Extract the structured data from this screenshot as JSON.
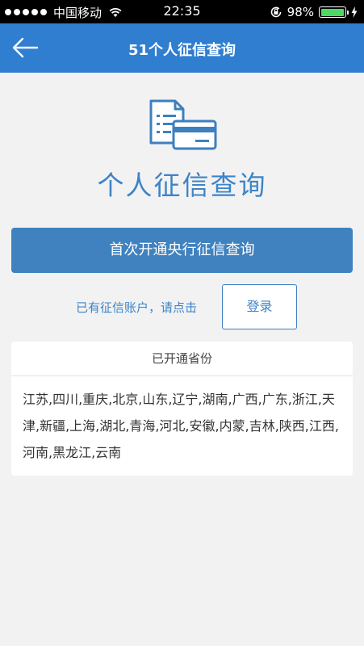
{
  "status_bar": {
    "carrier": "中国移动",
    "time": "22:35",
    "battery_percent": "98%",
    "battery_level": 0.98,
    "signal_bars": 5
  },
  "navbar": {
    "title": "51个人征信查询",
    "color": "#2f7ed0"
  },
  "hero": {
    "title": "个人征信查询"
  },
  "primary_button": {
    "label": "首次开通央行征信查询"
  },
  "login": {
    "hint": "已有征信账户，请点击",
    "button_label": "登录"
  },
  "provinces": {
    "header": "已开通省份",
    "list": "江苏,四川,重庆,北京,山东,辽宁,湖南,广西,广东,浙江,天津,新疆,上海,湖北,青海,河北,安徽,内蒙,吉林,陕西,江西,河南,黑龙江,云南"
  },
  "icons": {
    "back": "back-arrow-icon",
    "hero": "document-card-icon",
    "wifi": "wifi-icon",
    "lock": "rotation-lock-icon",
    "battery": "battery-icon",
    "charging": "charging-bolt-icon"
  }
}
